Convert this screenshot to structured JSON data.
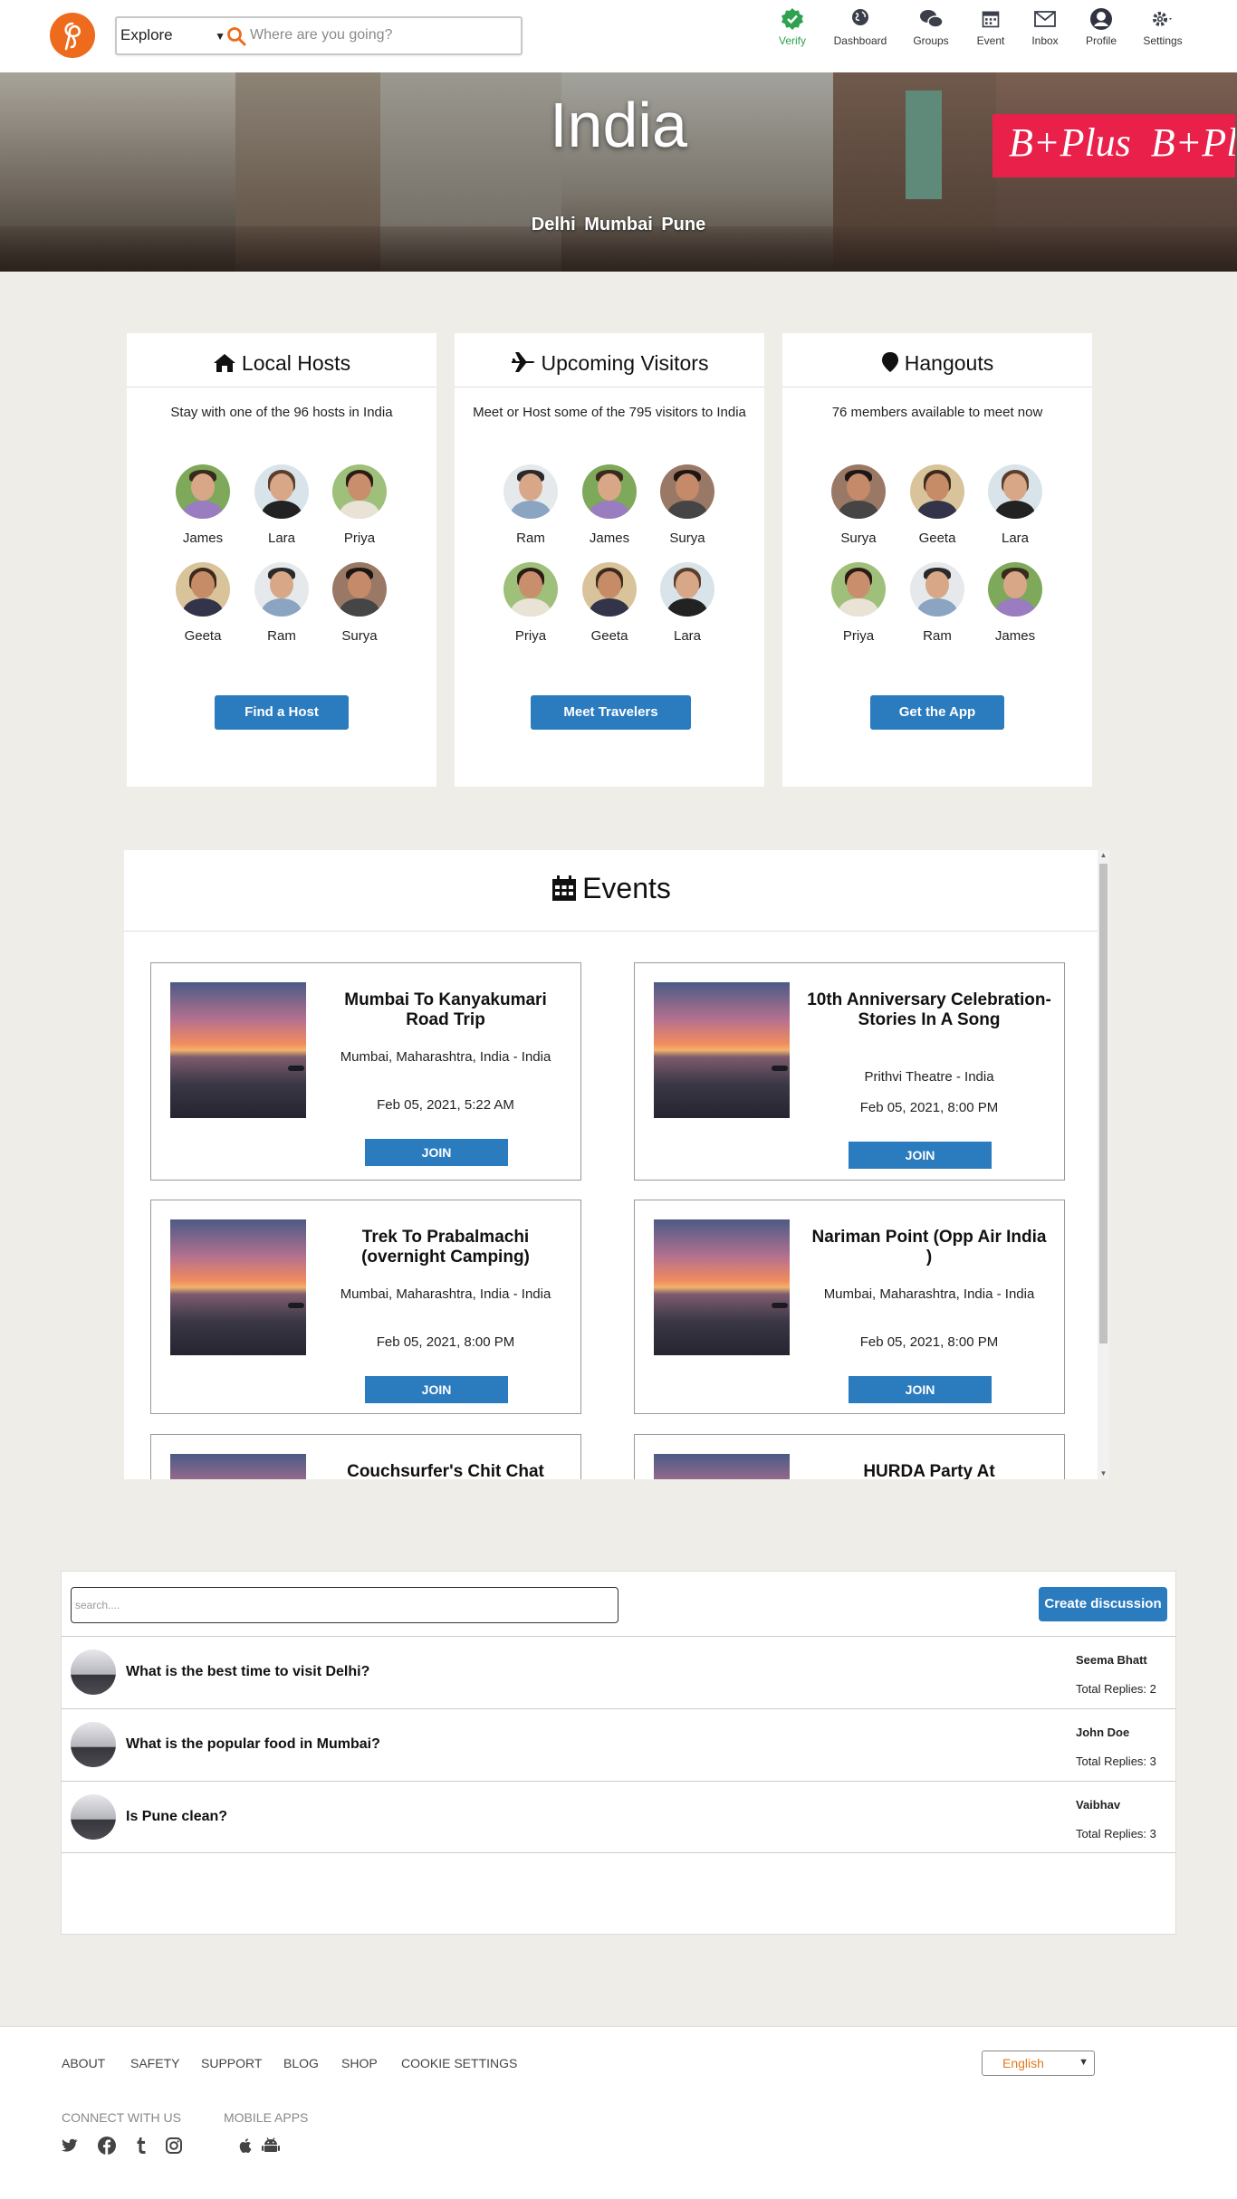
{
  "header": {
    "explore_label": "Explore",
    "search_placeholder": "Where are you going?",
    "nav": [
      {
        "label": "Verify"
      },
      {
        "label": "Dashboard"
      },
      {
        "label": "Groups"
      },
      {
        "label": "Event"
      },
      {
        "label": "Inbox"
      },
      {
        "label": "Profile"
      },
      {
        "label": "Settings"
      }
    ],
    "colors": {
      "brand": "#ee6a1c",
      "verify": "#2fa24f",
      "button": "#2b7bbf"
    }
  },
  "hero": {
    "title": "India",
    "cities": [
      "Delhi",
      "Mumbai",
      "Pune"
    ],
    "sign_text": "B+Plus"
  },
  "cards": [
    {
      "title": "Local Hosts",
      "icon": "home-icon",
      "subtitle": "Stay with one of the 96 hosts in India",
      "people": [
        "James",
        "Lara",
        "Priya",
        "Geeta",
        "Ram",
        "Surya"
      ],
      "button": "Find a Host"
    },
    {
      "title": "Upcoming Visitors",
      "icon": "plane-icon",
      "subtitle": "Meet or Host some of the 795 visitors to India",
      "people": [
        "Ram",
        "James",
        "Surya",
        "Priya",
        "Geeta",
        "Lara"
      ],
      "button": "Meet Travelers"
    },
    {
      "title": "Hangouts",
      "icon": "map-pin-icon",
      "subtitle": "76 members available to meet now",
      "people": [
        "Surya",
        "Geeta",
        "Lara",
        "Priya",
        "Ram",
        "James"
      ],
      "button": "Get the App"
    }
  ],
  "events": {
    "title": "Events",
    "join_label": "JOIN",
    "items": [
      {
        "title": "Mumbai To Kanyakumari Road Trip",
        "location": "Mumbai, Maharashtra, India - India",
        "date": "Feb 05, 2021, 5:22 AM"
      },
      {
        "title": "10th Anniversary Celebration- Stories In A Song",
        "location": "Prithvi Theatre - India",
        "date": "Feb 05, 2021, 8:00 PM"
      },
      {
        "title": "Trek To Prabalmachi (overnight Camping)",
        "location": "Mumbai, Maharashtra, India - India",
        "date": "Feb 05, 2021, 8:00 PM"
      },
      {
        "title": "Nariman Point (Opp Air India )",
        "location": "Mumbai, Maharashtra, India - India",
        "date": "Feb 05, 2021, 8:00 PM"
      },
      {
        "title": "Couchsurfer's Chit Chat",
        "location": "",
        "date": ""
      },
      {
        "title": "HURDA Party At",
        "location": "",
        "date": ""
      }
    ]
  },
  "discussions": {
    "search_placeholder": "search....",
    "create_label": "Create discussion",
    "replies_prefix": "Total Replies:",
    "items": [
      {
        "question": "What is the best time to visit Delhi?",
        "author": "Seema Bhatt",
        "replies": "Total Replies: 2"
      },
      {
        "question": "What is the popular food in Mumbai?",
        "author": "John Doe",
        "replies": "Total Replies: 3"
      },
      {
        "question": "Is Pune clean?",
        "author": "Vaibhav",
        "replies": "Total Replies: 3"
      }
    ]
  },
  "footer": {
    "links": [
      "ABOUT",
      "SAFETY",
      "SUPPORT",
      "BLOG",
      "SHOP",
      "COOKIE SETTINGS"
    ],
    "language": "English",
    "connect_heading": "CONNECT WITH US",
    "apps_heading": "MOBILE APPS",
    "social_icons": [
      "twitter-icon",
      "facebook-icon",
      "tumblr-icon",
      "instagram-icon"
    ],
    "app_icons": [
      "apple-icon",
      "android-icon"
    ]
  }
}
